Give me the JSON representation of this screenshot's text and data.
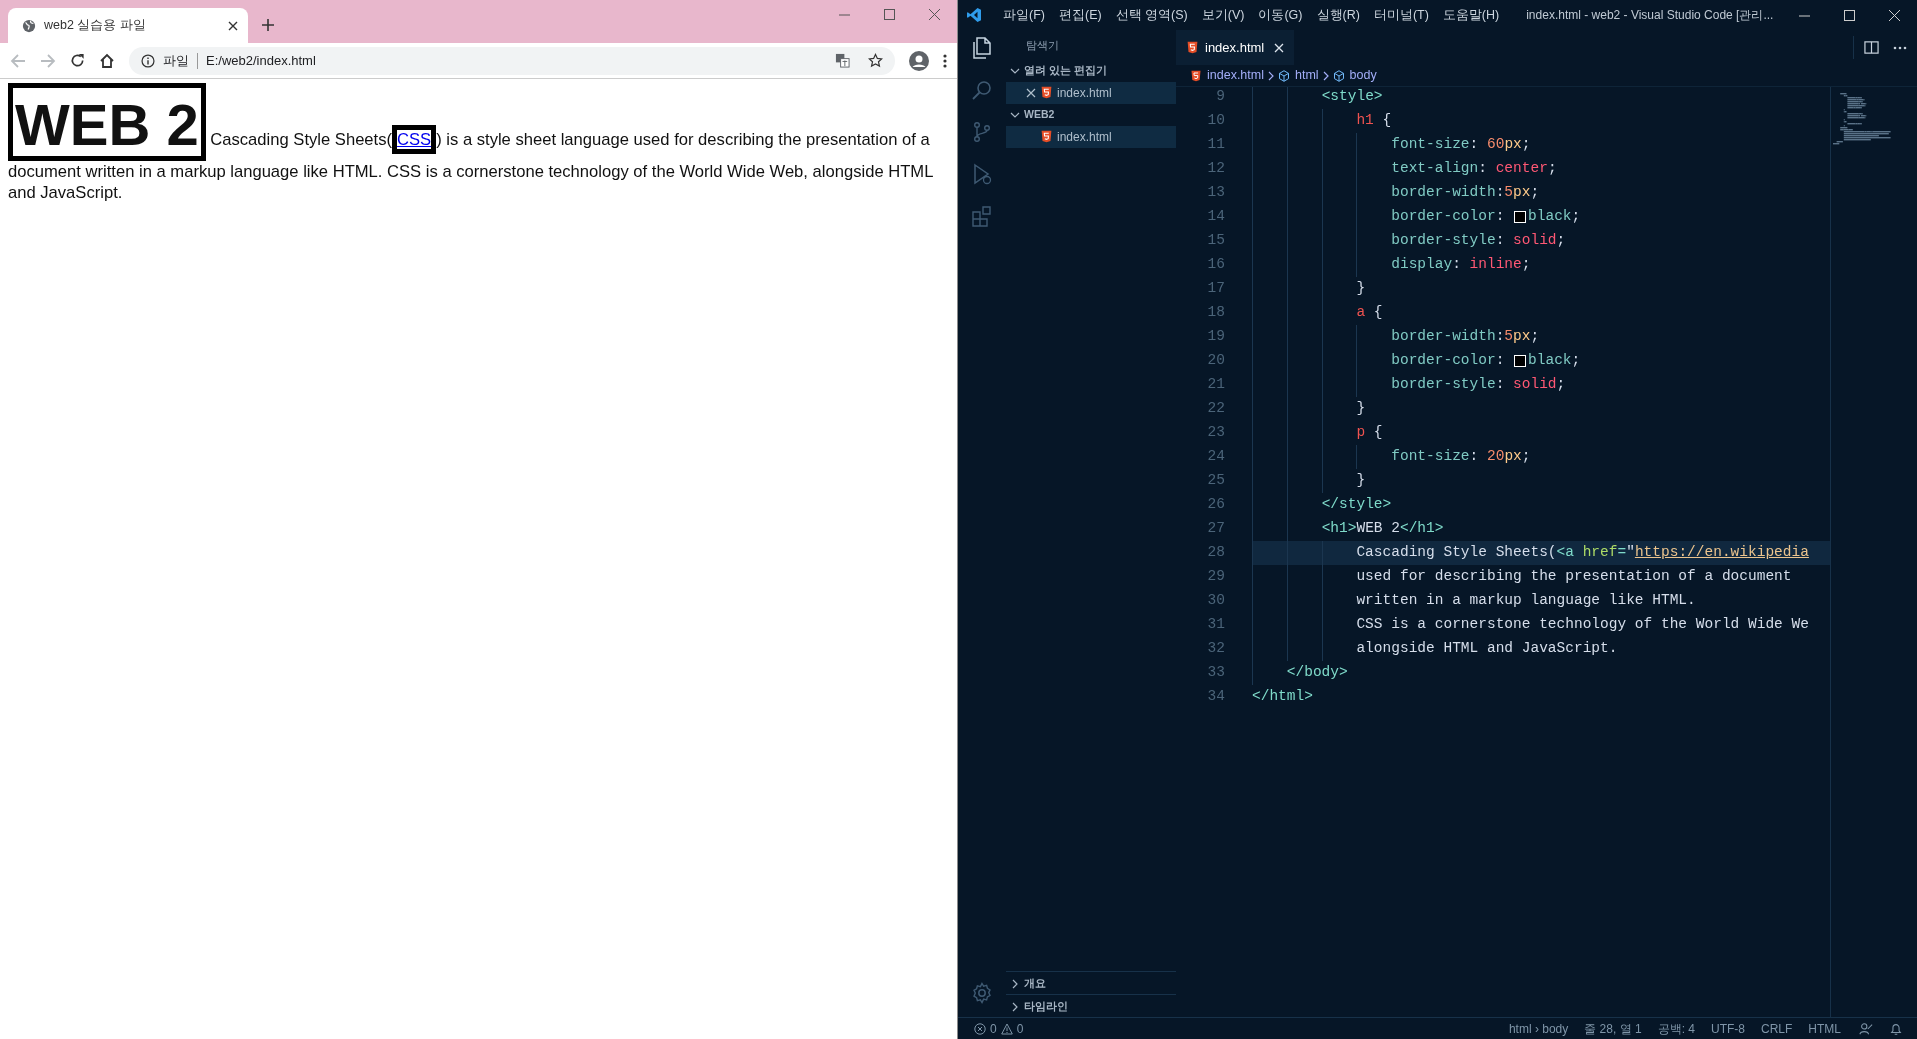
{
  "browser": {
    "tabs": [
      {
        "title": "web2 실습용 파일",
        "selected": true
      }
    ],
    "navigation": {
      "back": {
        "disabled": true
      },
      "forward": {
        "disabled": true
      }
    },
    "address": {
      "scheme_label": "파일",
      "url": "E:/web2/index.html"
    },
    "page": {
      "heading": "WEB 2",
      "paragraph": {
        "before": "Cascading Style Sheets(",
        "link": "CSS",
        "after": ") is a style sheet language used for describing the presentation of a",
        "continuation": "document written in a markup language like HTML. CSS is a cornerstone technology of the World Wide Web, alongside HTML and JavaScript."
      }
    }
  },
  "editor_window": {
    "title": "index.html - web2 - Visual Studio Code [관리...",
    "menu": [
      "파일(F)",
      "편집(E)",
      "선택 영역(S)",
      "보기(V)",
      "이동(G)",
      "실행(R)",
      "터미널(T)",
      "도움말(H)"
    ],
    "activity_bar": [
      {
        "kind": "explorer",
        "selected": true
      },
      {
        "kind": "search",
        "selected": false
      },
      {
        "kind": "source_control",
        "selected": false
      },
      {
        "kind": "run",
        "selected": false
      },
      {
        "kind": "extensions",
        "selected": false
      }
    ],
    "sidebar": {
      "title": "탐색기",
      "sections": [
        {
          "label": "열려 있는 편집기",
          "expanded": true,
          "items": [
            {
              "label": "index.html",
              "closable": true,
              "selected": true
            }
          ]
        },
        {
          "label": "WEB2",
          "expanded": true,
          "items": [
            {
              "label": "index.html",
              "closable": false,
              "selected": true
            }
          ]
        },
        {
          "label": "개요",
          "expanded": false
        },
        {
          "label": "타임라인",
          "expanded": false
        }
      ]
    },
    "tabs": [
      {
        "label": "index.html",
        "selected": true
      }
    ],
    "breadcrumbs": [
      {
        "kind": "file",
        "label": "index.html"
      },
      {
        "kind": "element",
        "label": "html"
      },
      {
        "kind": "element",
        "label": "body"
      }
    ],
    "lines": [
      {
        "number": "9",
        "current": false,
        "tokens": [
          {
            "kind": "tag",
            "text": "        <style>"
          }
        ]
      },
      {
        "number": "10",
        "current": false,
        "tokens": [
          {
            "kind": "selector",
            "text": "            h1"
          },
          {
            "kind": "punct",
            "text": " {"
          }
        ]
      },
      {
        "number": "11",
        "current": false,
        "tokens": [
          {
            "kind": "prop",
            "text": "                font-size"
          },
          {
            "kind": "punct",
            "text": ": "
          },
          {
            "kind": "num",
            "text": "60"
          },
          {
            "kind": "unit",
            "text": "px"
          },
          {
            "kind": "punct",
            "text": ";"
          }
        ]
      },
      {
        "number": "12",
        "current": false,
        "tokens": [
          {
            "kind": "prop",
            "text": "                text-align"
          },
          {
            "kind": "punct",
            "text": ": "
          },
          {
            "kind": "value",
            "text": "center"
          },
          {
            "kind": "punct",
            "text": ";"
          }
        ]
      },
      {
        "number": "13",
        "current": false,
        "tokens": [
          {
            "kind": "prop",
            "text": "                border-width"
          },
          {
            "kind": "punct",
            "text": ":"
          },
          {
            "kind": "num",
            "text": "5"
          },
          {
            "kind": "unit",
            "text": "px"
          },
          {
            "kind": "punct",
            "text": ";"
          }
        ]
      },
      {
        "number": "14",
        "current": false,
        "tokens": [
          {
            "kind": "prop",
            "text": "                border-color"
          },
          {
            "kind": "punct",
            "text": ": "
          },
          {
            "kind": "swatch"
          },
          {
            "kind": "keyword",
            "text": "black"
          },
          {
            "kind": "punct",
            "text": ";"
          }
        ]
      },
      {
        "number": "15",
        "current": false,
        "tokens": [
          {
            "kind": "prop",
            "text": "                border-style"
          },
          {
            "kind": "punct",
            "text": ": "
          },
          {
            "kind": "value",
            "text": "solid"
          },
          {
            "kind": "punct",
            "text": ";"
          }
        ]
      },
      {
        "number": "16",
        "current": false,
        "tokens": [
          {
            "kind": "prop",
            "text": "                display"
          },
          {
            "kind": "punct",
            "text": ": "
          },
          {
            "kind": "value",
            "text": "inline"
          },
          {
            "kind": "punct",
            "text": ";"
          }
        ]
      },
      {
        "number": "17",
        "current": false,
        "tokens": [
          {
            "kind": "punct",
            "text": "            }"
          }
        ]
      },
      {
        "number": "18",
        "current": false,
        "tokens": [
          {
            "kind": "selector",
            "text": "            a"
          },
          {
            "kind": "punct",
            "text": " {"
          }
        ]
      },
      {
        "number": "19",
        "current": false,
        "tokens": [
          {
            "kind": "prop",
            "text": "                border-width"
          },
          {
            "kind": "punct",
            "text": ":"
          },
          {
            "kind": "num",
            "text": "5"
          },
          {
            "kind": "unit",
            "text": "px"
          },
          {
            "kind": "punct",
            "text": ";"
          }
        ]
      },
      {
        "number": "20",
        "current": false,
        "tokens": [
          {
            "kind": "prop",
            "text": "                border-color"
          },
          {
            "kind": "punct",
            "text": ": "
          },
          {
            "kind": "swatch"
          },
          {
            "kind": "keyword",
            "text": "black"
          },
          {
            "kind": "punct",
            "text": ";"
          }
        ]
      },
      {
        "number": "21",
        "current": false,
        "tokens": [
          {
            "kind": "prop",
            "text": "                border-style"
          },
          {
            "kind": "punct",
            "text": ": "
          },
          {
            "kind": "value",
            "text": "solid"
          },
          {
            "kind": "punct",
            "text": ";"
          }
        ]
      },
      {
        "number": "22",
        "current": false,
        "tokens": [
          {
            "kind": "punct",
            "text": "            }"
          }
        ]
      },
      {
        "number": "23",
        "current": false,
        "tokens": [
          {
            "kind": "selector",
            "text": "            p"
          },
          {
            "kind": "punct",
            "text": " {"
          }
        ]
      },
      {
        "number": "24",
        "current": false,
        "tokens": [
          {
            "kind": "prop",
            "text": "                font-size"
          },
          {
            "kind": "punct",
            "text": ": "
          },
          {
            "kind": "num",
            "text": "20"
          },
          {
            "kind": "unit",
            "text": "px"
          },
          {
            "kind": "punct",
            "text": ";"
          }
        ]
      },
      {
        "number": "25",
        "current": false,
        "tokens": [
          {
            "kind": "punct",
            "text": "            }"
          }
        ]
      },
      {
        "number": "26",
        "current": false,
        "tokens": [
          {
            "kind": "tag",
            "text": "        </style>"
          }
        ]
      },
      {
        "number": "27",
        "current": false,
        "tokens": [
          {
            "kind": "tag",
            "text": "        <h1>"
          },
          {
            "kind": "text",
            "text": "WEB 2"
          },
          {
            "kind": "tag",
            "text": "</h1>"
          }
        ]
      },
      {
        "number": "28",
        "current": true,
        "tokens": [
          {
            "kind": "text",
            "text": "            Cascading Style Sheets("
          },
          {
            "kind": "tag",
            "text": "<a"
          },
          {
            "kind": "attr",
            "text": " href"
          },
          {
            "kind": "tag",
            "text": "="
          },
          {
            "kind": "string",
            "text": "\""
          },
          {
            "kind": "url",
            "text": "https://en.wikipedia"
          }
        ]
      },
      {
        "number": "29",
        "current": false,
        "tokens": [
          {
            "kind": "text",
            "text": "            used for describing the presentation of a document"
          }
        ]
      },
      {
        "number": "30",
        "current": false,
        "tokens": [
          {
            "kind": "text",
            "text": "            written in a markup language like HTML."
          }
        ]
      },
      {
        "number": "31",
        "current": false,
        "tokens": [
          {
            "kind": "text",
            "text": "            CSS is a cornerstone technology of the World Wide We"
          }
        ]
      },
      {
        "number": "32",
        "current": false,
        "tokens": [
          {
            "kind": "text",
            "text": "            alongside HTML and JavaScript."
          }
        ]
      },
      {
        "number": "33",
        "current": false,
        "tokens": [
          {
            "kind": "tag",
            "text": "    </body>"
          }
        ]
      },
      {
        "number": "34",
        "current": false,
        "tokens": [
          {
            "kind": "tag",
            "text": "</html>"
          }
        ]
      }
    ],
    "status_bar": {
      "errors": "0",
      "warnings": "0",
      "items": [
        "html › body",
        "줄 28, 열 1",
        "공백: 4",
        "UTF-8",
        "CRLF",
        "HTML"
      ]
    }
  }
}
